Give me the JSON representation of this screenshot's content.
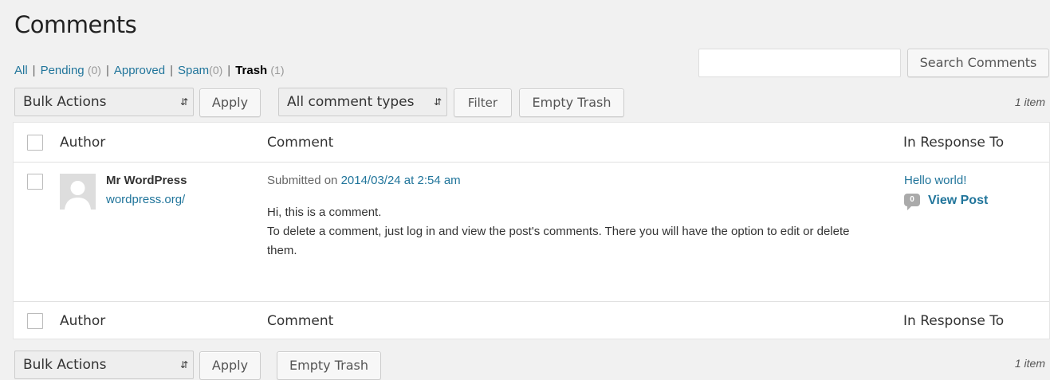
{
  "page": {
    "title": "Comments"
  },
  "filters": {
    "all": "All",
    "pending": "Pending",
    "pending_count": "(0)",
    "approved": "Approved",
    "spam": "Spam",
    "spam_count": "(0)",
    "trash": "Trash",
    "trash_count": "(1)",
    "separator": "|"
  },
  "search": {
    "button": "Search Comments",
    "placeholder": ""
  },
  "top_actions": {
    "bulk_select": "Bulk Actions",
    "apply": "Apply",
    "type_select": "All comment types",
    "filter": "Filter",
    "empty_trash": "Empty Trash",
    "count": "1 item"
  },
  "bottom_actions": {
    "bulk_select": "Bulk Actions",
    "apply": "Apply",
    "empty_trash": "Empty Trash",
    "count": "1 item"
  },
  "table": {
    "columns": [
      "Author",
      "Comment",
      "In Response To"
    ],
    "rows": [
      {
        "author_name": "Mr WordPress",
        "author_url": "wordpress.org/",
        "submitted_prefix": "Submitted on",
        "submitted_date": "2014/03/24 at 2:54 am",
        "comment_line1": "Hi, this is a comment.",
        "comment_line2": "To delete a comment, just log in and view the post's comments. There you will have the option to edit or delete them.",
        "post_title": "Hello world!",
        "comment_count": "0",
        "view_post": "View Post"
      }
    ]
  },
  "colors": {
    "link": "#21759b",
    "background": "#f1f1f1"
  }
}
